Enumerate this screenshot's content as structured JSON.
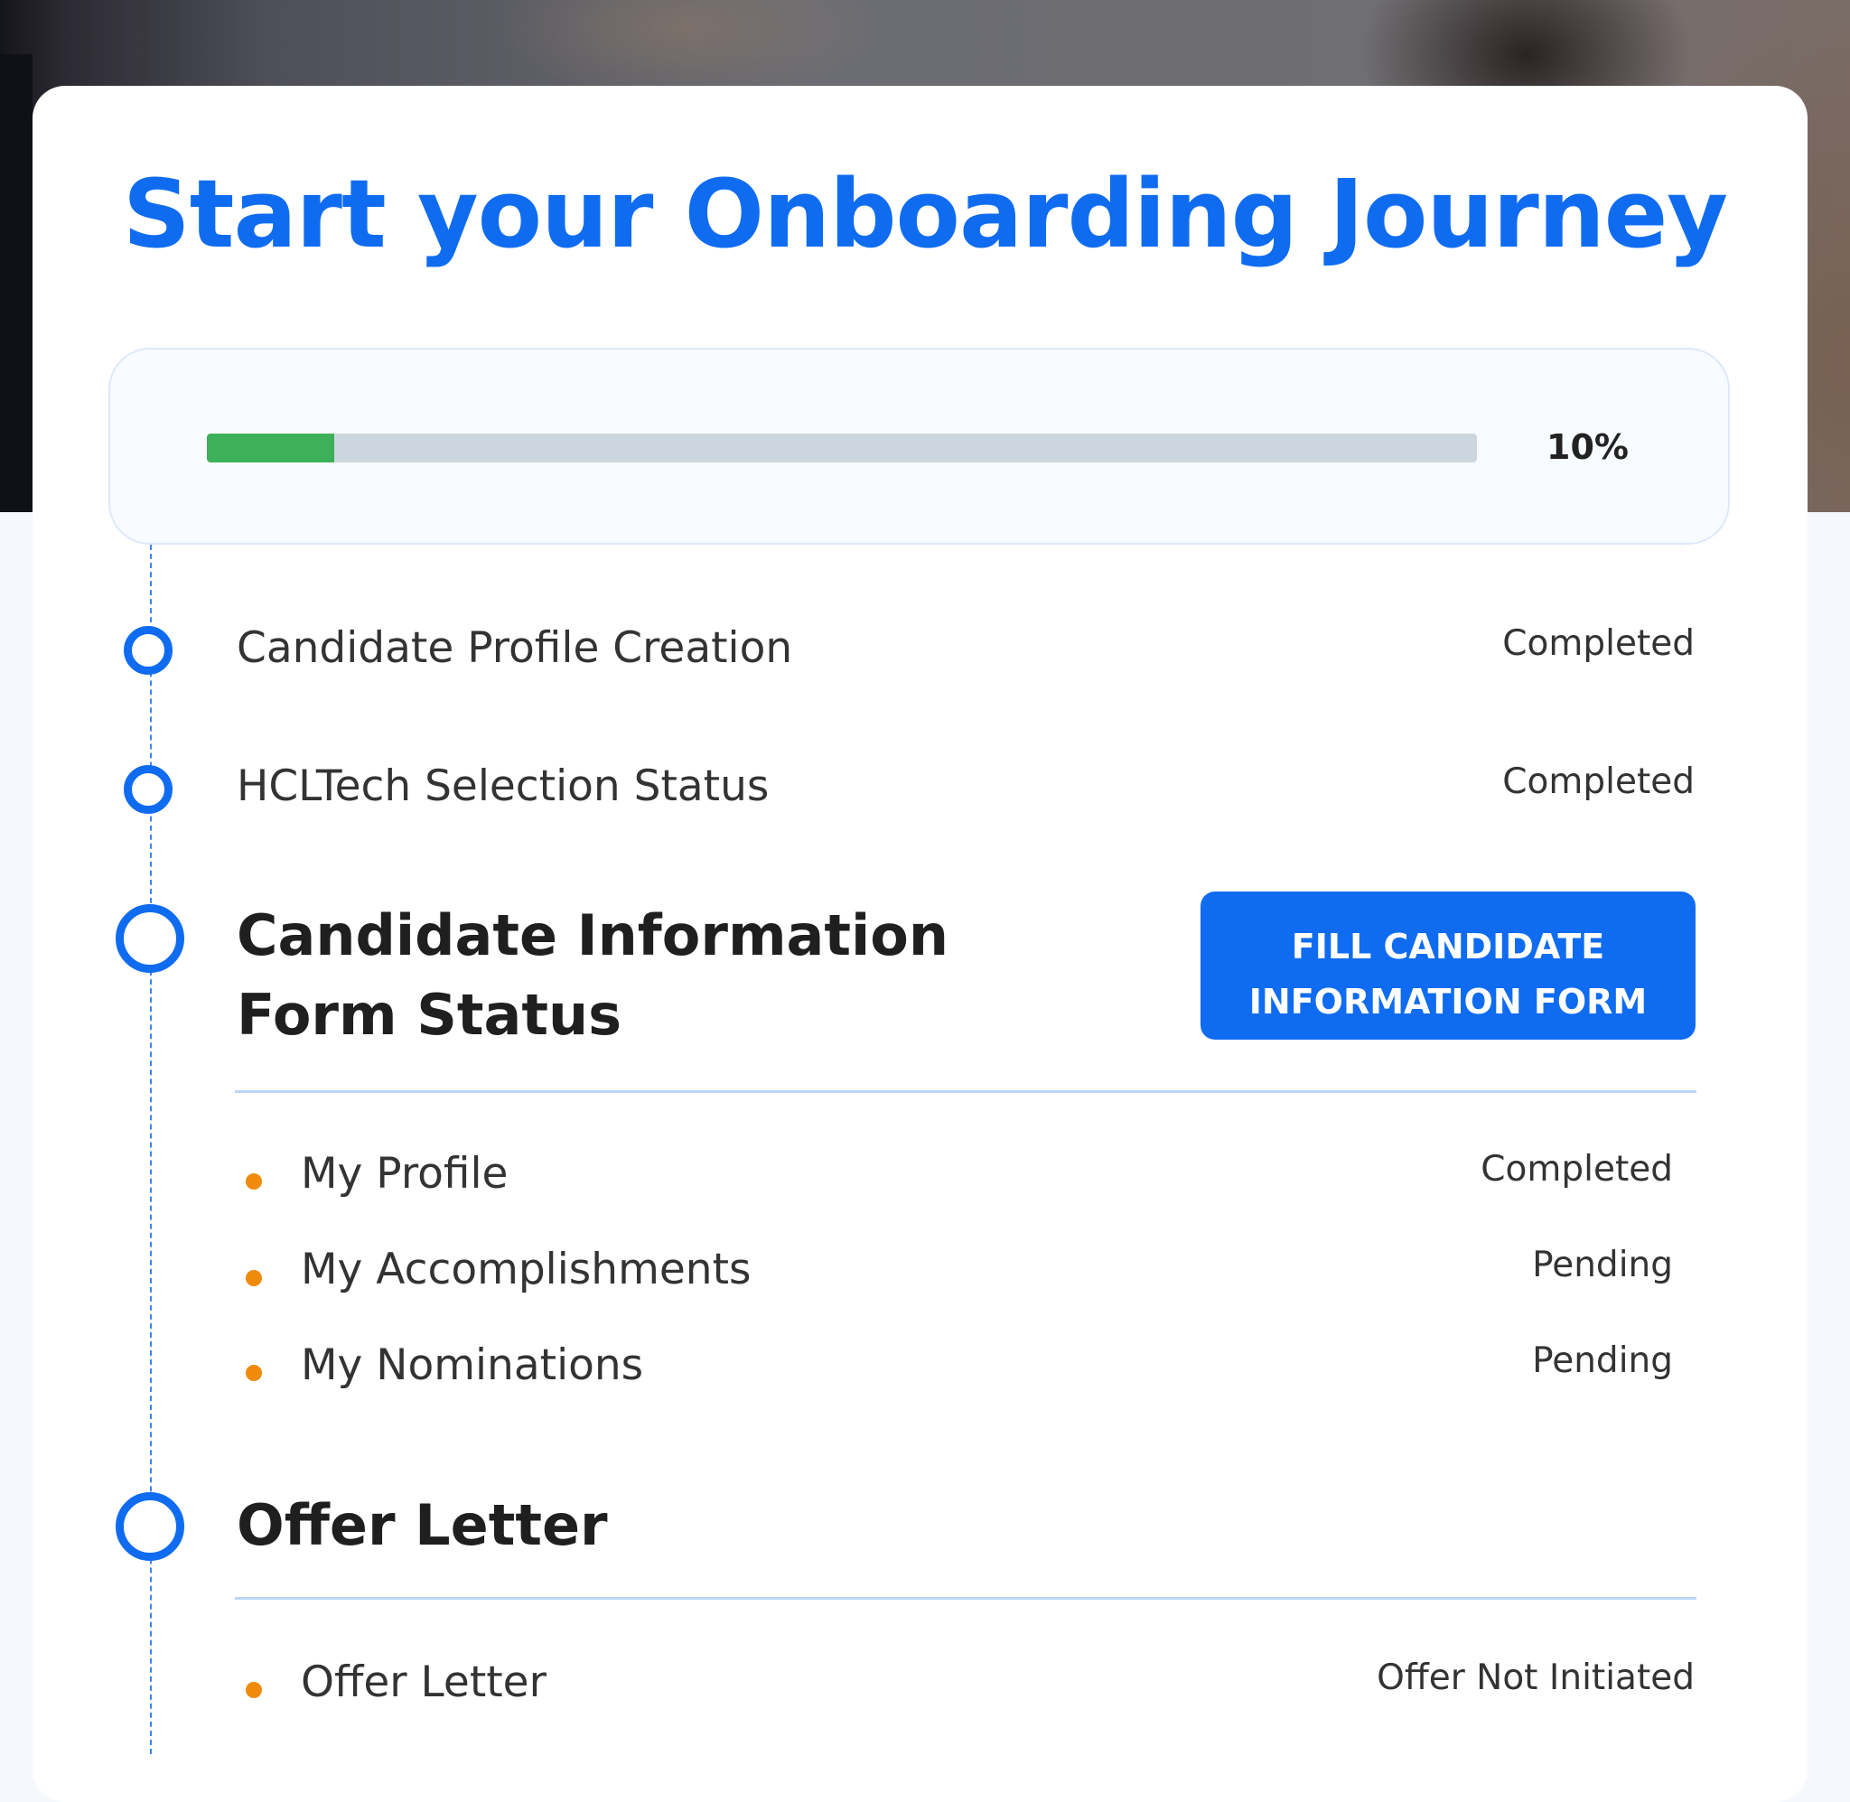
{
  "page": {
    "title": "Start your Onboarding Journey"
  },
  "progress": {
    "value_percent": 10,
    "label": "10%",
    "fill_color": "#3db15a",
    "track_color": "#cdd5df"
  },
  "theme": {
    "accent": "#0f6cf0",
    "bullet": "#f08a0b"
  },
  "steps": [
    {
      "label": "Candidate Profile Creation",
      "status": "Completed"
    },
    {
      "label": "HCLTech Selection Status",
      "status": "Completed"
    }
  ],
  "candidate_form": {
    "title_line1": "Candidate Information",
    "title_line2": "Form Status",
    "button_line1": "FILL CANDIDATE",
    "button_line2": "INFORMATION FORM",
    "items": [
      {
        "label": "My Profile",
        "status": "Completed"
      },
      {
        "label": "My Accomplishments",
        "status": "Pending"
      },
      {
        "label": "My Nominations",
        "status": "Pending"
      }
    ]
  },
  "offer_letter": {
    "title": "Offer Letter",
    "items": [
      {
        "label": "Offer Letter",
        "status": "Offer Not Initiated"
      }
    ]
  }
}
